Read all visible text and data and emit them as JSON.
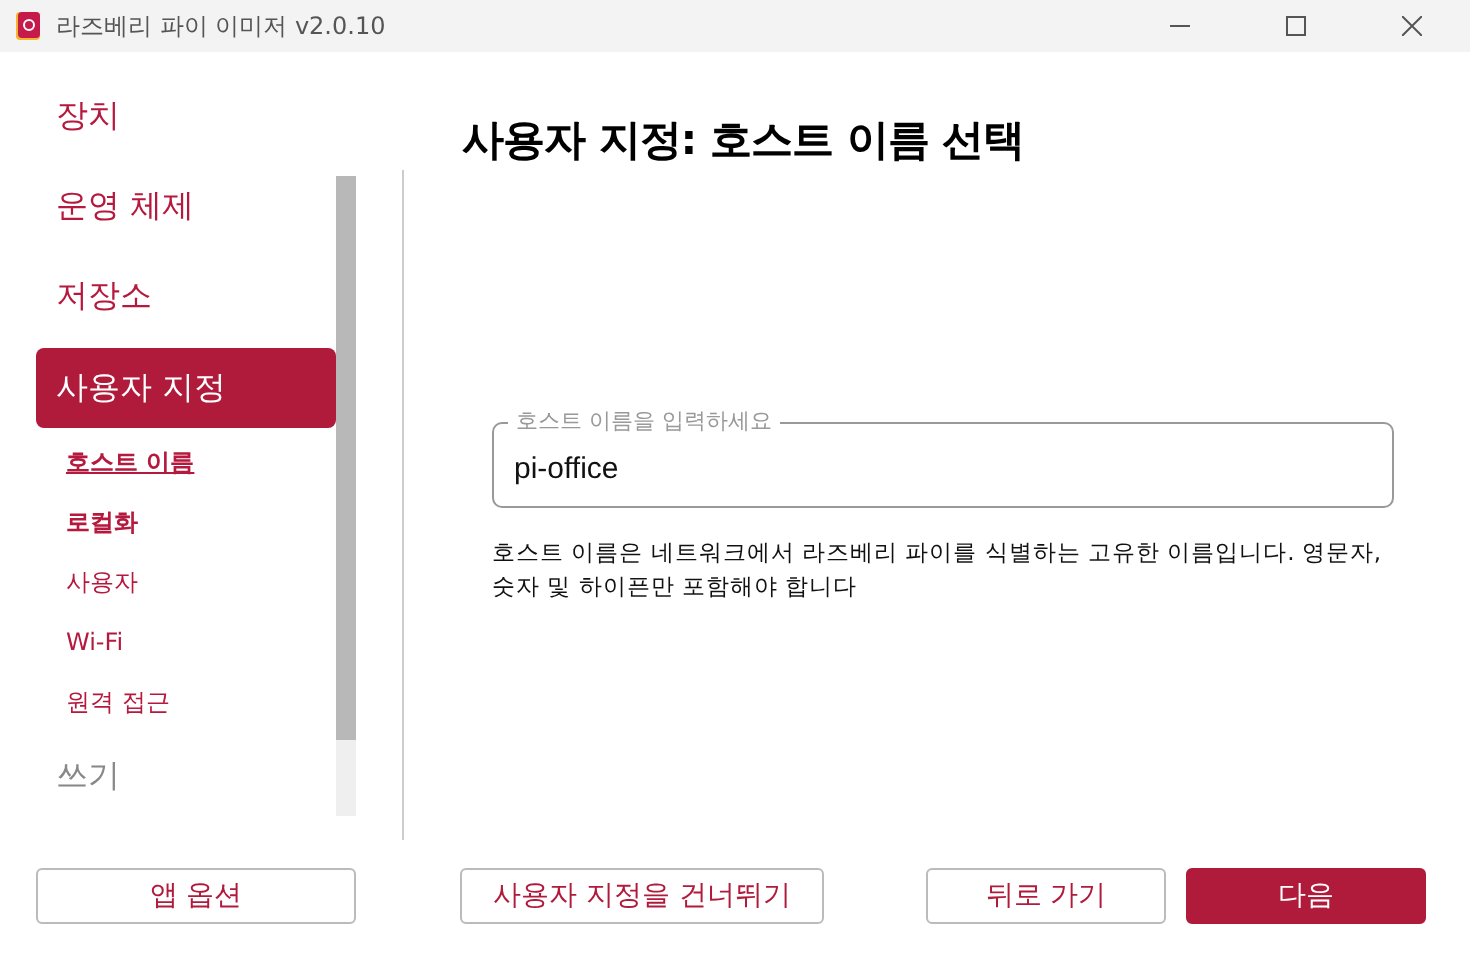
{
  "window": {
    "title": "라즈베리 파이 이미저 v2.0.10"
  },
  "sidebar": {
    "items": [
      {
        "label": "장치",
        "selected": false,
        "disabled": false
      },
      {
        "label": "운영 체제",
        "selected": false,
        "disabled": false
      },
      {
        "label": "저장소",
        "selected": false,
        "disabled": false
      },
      {
        "label": "사용자 지정",
        "selected": true,
        "disabled": false,
        "children": [
          {
            "label": "호스트 이름",
            "selected": true,
            "bold": true
          },
          {
            "label": "로컬화",
            "selected": false,
            "bold": true
          },
          {
            "label": "사용자",
            "selected": false,
            "bold": false
          },
          {
            "label": "Wi-Fi",
            "selected": false,
            "bold": false
          },
          {
            "label": "원격 접근",
            "selected": false,
            "bold": false
          }
        ]
      },
      {
        "label": "쓰기",
        "selected": false,
        "disabled": true
      }
    ]
  },
  "heading": "사용자 지정: 호스트 이름 선택",
  "hostname_field": {
    "placeholder": "호스트 이름을 입력하세요",
    "value": "pi-office"
  },
  "help_text": "호스트 이름은 네트워크에서 라즈베리 파이를 식별하는 고유한 이름입니다. 영문자, 숫자 및 하이픈만 포함해야 합니다",
  "buttons": [
    {
      "label": "앱 옵션",
      "kind": "outline"
    },
    {
      "label": "사용자 지정을 건너뛰기",
      "kind": "outline"
    },
    {
      "label": "뒤로 가기",
      "kind": "outline"
    },
    {
      "label": "다음",
      "kind": "primary"
    }
  ]
}
